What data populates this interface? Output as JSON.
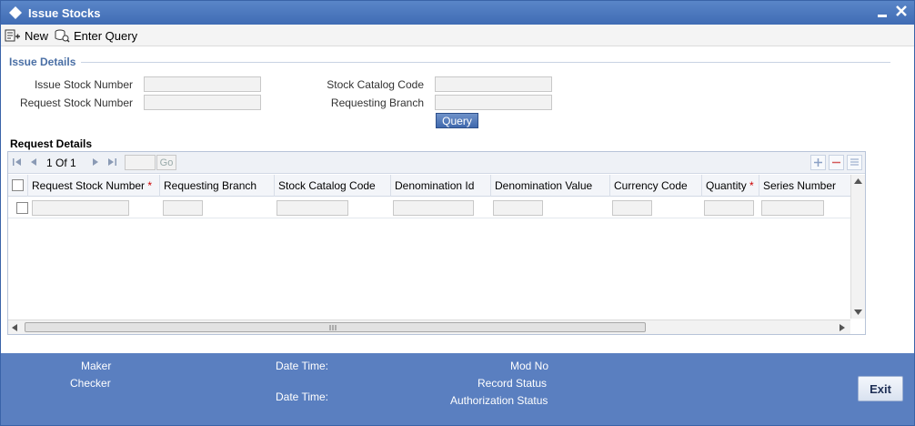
{
  "window": {
    "title": "Issue Stocks"
  },
  "toolbar": {
    "new_label": "New",
    "enter_query_label": "Enter Query"
  },
  "issue_details": {
    "section_title": "Issue Details",
    "issue_stock_number_label": "Issue Stock Number",
    "issue_stock_number_value": "",
    "request_stock_number_label": "Request Stock Number",
    "request_stock_number_value": "",
    "stock_catalog_code_label": "Stock Catalog Code",
    "stock_catalog_code_value": "",
    "requesting_branch_label": "Requesting Branch",
    "requesting_branch_value": "",
    "query_button_label": "Query"
  },
  "request_details": {
    "section_title": "Request Details",
    "pager": {
      "current_page": "1",
      "of_label": "Of",
      "total_pages": "1",
      "go_label": "Go"
    },
    "columns": [
      {
        "label": "Request Stock Number",
        "required": "*"
      },
      {
        "label": "Requesting Branch",
        "required": ""
      },
      {
        "label": "Stock Catalog Code",
        "required": ""
      },
      {
        "label": "Denomination Id",
        "required": ""
      },
      {
        "label": "Denomination Value",
        "required": ""
      },
      {
        "label": "Currency Code",
        "required": ""
      },
      {
        "label": "Quantity",
        "required": "*"
      },
      {
        "label": "Series Number",
        "required": ""
      }
    ]
  },
  "footer": {
    "maker_label": "Maker",
    "checker_label": "Checker",
    "date_time_label_1": "Date Time:",
    "date_time_label_2": "Date Time:",
    "mod_no_label": "Mod No",
    "record_status_label": "Record Status",
    "authorization_status_label": "Authorization Status",
    "exit_label": "Exit"
  },
  "colors": {
    "title_bar": "#3f6cb4",
    "section_title": "#4a6fa5",
    "footer": "#5a7fc0",
    "required_marker": "#cc0000"
  }
}
